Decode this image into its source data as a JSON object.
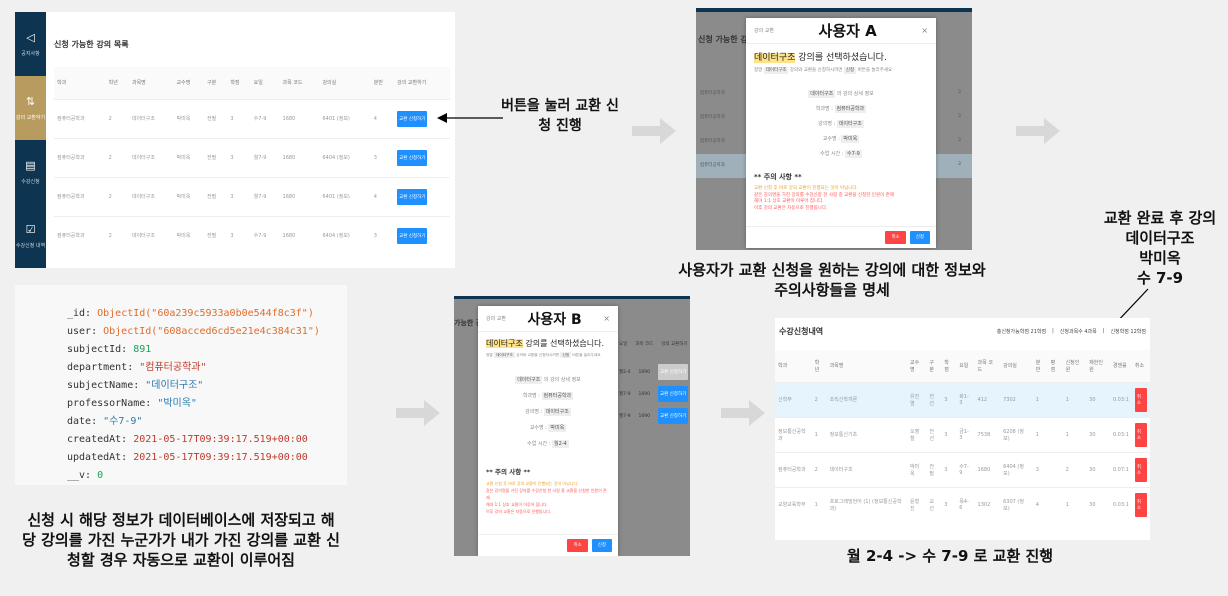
{
  "panel1": {
    "sidebar": [
      {
        "icon": "megaphone-icon",
        "label": "공지사항"
      },
      {
        "icon": "exchange-icon",
        "label": "강의 교환하기",
        "active": true
      },
      {
        "icon": "list-icon",
        "label": "수강신청"
      },
      {
        "icon": "clipboard-icon",
        "label": "수강신청 내역"
      }
    ],
    "title": "신청 가능한 강의 목록",
    "columns": [
      "학과",
      "학년",
      "과목명",
      "교수명",
      "구분",
      "학점",
      "요일",
      "과목 코드",
      "강의실",
      "분반",
      "강의 교환하기"
    ],
    "rows": [
      [
        "컴퓨터공학과",
        "2",
        "데이터구조",
        "박미옥",
        "전필",
        "3",
        "수7-9",
        "1680",
        "6401 (정보)",
        "4",
        "교환 신청하기"
      ],
      [
        "컴퓨터공학과",
        "2",
        "데이터구조",
        "박미옥",
        "전필",
        "3",
        "월7-9",
        "1680",
        "6404 (정보)",
        "3",
        "교환 신청하기"
      ],
      [
        "컴퓨터공학과",
        "2",
        "데이터구조",
        "박미옥",
        "전필",
        "3",
        "월7-9",
        "1680",
        "6401 (정보)",
        "4",
        "교환 신청하기"
      ],
      [
        "컴퓨터공학과",
        "2",
        "데이터구조",
        "박미옥",
        "전필",
        "3",
        "수7-9",
        "1680",
        "6404 (정보)",
        "3",
        "교환 신청하기"
      ]
    ]
  },
  "annotation_button": "버튼을 눌러 교환 신청 진행",
  "modalA": {
    "user_label": "사용자 A",
    "header": "강의 교환",
    "bg_title": "신청 가능한 강",
    "bg_col_dept": "학과",
    "bg_col_year": "학년",
    "bg_dept": "컴퓨터공학과",
    "bg_val": "3",
    "bg_type": "전필",
    "course": "데이터구조",
    "heading_suffix": "강의를 선택하셨습니다.",
    "instr_pre": "정말",
    "instr_mid": "강의와 교환을 신청하시려면",
    "instr_btn": "신청",
    "instr_post": "버튼을 눌러주세요",
    "detail_suffix": "의 강의 상세 정보",
    "fields": [
      {
        "label": "학과명 :",
        "value": "컴퓨터공학과"
      },
      {
        "label": "강의명 :",
        "value": "데이터구조"
      },
      {
        "label": "교수명 :",
        "value": "박미옥"
      },
      {
        "label": "수업 시간 :",
        "value": "수7-9"
      }
    ],
    "notice_title": "** 주의 사항 **",
    "notice": [
      "교환 신청 후 바로 강의 교환이 진행되는 것이 아닙니다.",
      "같은 강의명을 가진 강의를 수강신청 한 사람 중 교환을 신청한 인원이 존재",
      "해야 1:1 상호 교환이 이루어 집니다.",
      "이후 강의 교환은 자동으로 진행됩니다."
    ],
    "cancel": "취소",
    "submit": "신청"
  },
  "caption_modalA": "사용자가 교환 신청을 원하는 강의에 대한 정보와 주의사항들을 명세",
  "annotation_result": [
    "교환 완료 후 강의",
    "데이터구조",
    "박미옥",
    "수 7-9"
  ],
  "db_record": {
    "_id": "ObjectId(\"60a239c5933a0b0e544f8c3f\")",
    "user": "ObjectId(\"608acced6cd5e21e4c384c31\")",
    "subjectId": "891",
    "department": "\"컴퓨터공학과\"",
    "subjectName": "\"데이터구조\"",
    "professorName": "\"박미옥\"",
    "date": "\"수7-9\"",
    "createdAt": "2021-05-17T09:39:17.519+00:00",
    "updatedAt": "2021-05-17T09:39:17.519+00:00",
    "__v": "0"
  },
  "caption_db": "신청 시 해당 정보가 데이터베이스에 저장되고 해당 강의를 가진 누군가가 내가 가진 강의를 교환 신청할 경우 자동으로 교환이 이루어짐",
  "modalB": {
    "user_label": "사용자 B",
    "header": "강의 교환",
    "bg_title": "가능한 강",
    "bg_cols": [
      "요일",
      "과목 코드",
      "강의 교환하기"
    ],
    "bg_rows": [
      [
        "월2-4",
        "1690",
        "교환 신청하기"
      ],
      [
        "월7-9",
        "1690",
        "교환 신청하기"
      ],
      [
        "월7-9",
        "1690",
        "교환 신청하기"
      ]
    ],
    "fields": [
      {
        "label": "학과명 :",
        "value": "컴퓨터공학과"
      },
      {
        "label": "강의명 :",
        "value": "데이터구조"
      },
      {
        "label": "교수명 :",
        "value": "박미옥"
      },
      {
        "label": "수업 시간 :",
        "value": "월2-4"
      }
    ]
  },
  "panel3": {
    "title": "수강신청내역",
    "summary": [
      "총신청가능학점 21학점",
      "신청과목수 4과목",
      "신청학점 12학점"
    ],
    "columns": [
      "학과",
      "학년",
      "과목명",
      "교수명",
      "구분",
      "학점",
      "요일",
      "과목 코드",
      "강의실",
      "분반",
      "평점",
      "신청인원",
      "제한인원",
      "경쟁률",
      "취소"
    ],
    "rows": [
      [
        "신학부",
        "2",
        "조직신학개론",
        "유진열",
        "전선",
        "3",
        "화1-3",
        "412",
        "7302",
        "1",
        "",
        "1",
        "30",
        "0.03:1",
        "취소"
      ],
      [
        "정보통신공학과",
        "1",
        "정보통신기초",
        "오영철",
        "전선",
        "3",
        "금1-3",
        "7538",
        "6208 (정보)",
        "1",
        "",
        "1",
        "30",
        "0.03:1",
        "취소"
      ],
      [
        "컴퓨터공학과",
        "2",
        "데이터구조",
        "박미옥",
        "전필",
        "3",
        "수7-9",
        "1680",
        "6404 (정보)",
        "3",
        "",
        "2",
        "30",
        "0.07:1",
        "취소"
      ],
      [
        "교양교육학부",
        "1",
        "프로그래밍언어 (1) (정보통신공학과)",
        "윤형진",
        "교선",
        "3",
        "목4-6",
        "1302",
        "6307 (정보)",
        "4",
        "",
        "1",
        "30",
        "0.03:1",
        "취소"
      ]
    ]
  },
  "caption_result": "월 2-4 -> 수 7-9 로 교환 진행",
  "colors": {
    "navy": "#0d3450",
    "gold": "#b89b5e",
    "blue": "#1e90ff",
    "red": "#ff4444",
    "highlight": "#ffe38a"
  }
}
